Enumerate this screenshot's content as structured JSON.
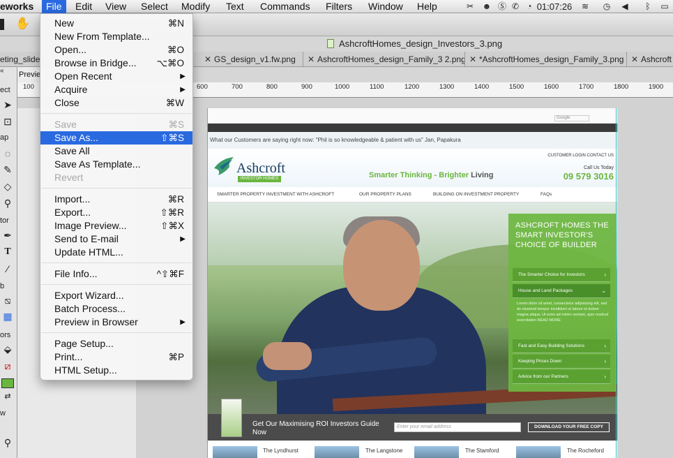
{
  "menubar": {
    "app": "eworks",
    "items": [
      "File",
      "Edit",
      "View",
      "Select",
      "Modify",
      "Text",
      "Commands",
      "Filters",
      "Window",
      "Help"
    ],
    "clock": "01:07:26"
  },
  "window": {
    "title": "AshcroftHomes_design_Investors_3.png"
  },
  "tabs": [
    {
      "label": "eting_slide"
    },
    {
      "label": "GS_design_v1.fw.png"
    },
    {
      "label": "AshcroftHomes_design_Family_3 2.png"
    },
    {
      "label": "*AshcroftHomes_design_Family_3.png"
    },
    {
      "label": "Ashcroft"
    }
  ],
  "preview_tab": "Previe",
  "tool_panel": {
    "labels": [
      "ect",
      "ap",
      "tor",
      "b",
      "ors",
      "w"
    ]
  },
  "ruler": {
    "ticks": [
      "100",
      "600",
      "700",
      "800",
      "900",
      "1000",
      "1100",
      "1200",
      "1300",
      "1400",
      "1500",
      "1600",
      "1700",
      "1800",
      "1900"
    ]
  },
  "file_menu": {
    "groups": [
      [
        {
          "label": "New",
          "shortcut": "⌘N"
        },
        {
          "label": "New From Template...",
          "shortcut": ""
        },
        {
          "label": "Open...",
          "shortcut": "⌘O"
        },
        {
          "label": "Browse in Bridge...",
          "shortcut": "⌥⌘O"
        },
        {
          "label": "Open Recent",
          "submenu": true
        },
        {
          "label": "Acquire",
          "submenu": true
        },
        {
          "label": "Close",
          "shortcut": "⌘W"
        }
      ],
      [
        {
          "label": "Save",
          "shortcut": "⌘S",
          "disabled": true
        },
        {
          "label": "Save As...",
          "shortcut": "⇧⌘S",
          "highlight": true
        },
        {
          "label": "Save All",
          "shortcut": ""
        },
        {
          "label": "Save As Template...",
          "shortcut": ""
        },
        {
          "label": "Revert",
          "shortcut": "",
          "disabled": true
        }
      ],
      [
        {
          "label": "Import...",
          "shortcut": "⌘R"
        },
        {
          "label": "Export...",
          "shortcut": "⇧⌘R"
        },
        {
          "label": "Image Preview...",
          "shortcut": "⇧⌘X"
        },
        {
          "label": "Send to E-mail",
          "submenu": true
        },
        {
          "label": "Update HTML...",
          "shortcut": ""
        }
      ],
      [
        {
          "label": "File Info...",
          "shortcut": "^⇧⌘F"
        }
      ],
      [
        {
          "label": "Export Wizard...",
          "shortcut": ""
        },
        {
          "label": "Batch Process...",
          "shortcut": ""
        },
        {
          "label": "Preview in Browser",
          "submenu": true
        }
      ],
      [
        {
          "label": "Page Setup...",
          "shortcut": ""
        },
        {
          "label": "Print...",
          "shortcut": "⌘P"
        },
        {
          "label": "HTML Setup...",
          "shortcut": ""
        }
      ]
    ]
  },
  "site": {
    "google_box": "Google",
    "testimonial": "What our Customers are saying right now: \"Phil is so knowledgeable & patient with us\" Jan, Papakura",
    "logo": {
      "name": "Ashcroft",
      "sub": "INVESTOR HOMES"
    },
    "tagline": {
      "green": "Smarter Thinking - ",
      "dark_1": "Brighter",
      "dark_2": " Living"
    },
    "top_links": "CUSTOMER LOGIN    CONTACT US",
    "call_label": "Call Us Today",
    "phone": "09 579 3016",
    "nav": [
      "SMARTER PROPERTY INVESTMENT WITH ASHCROFT",
      "OUR PROPERTY PLANS",
      "BUILDING ON INVESTMENT PROPERTY",
      "FAQs"
    ],
    "panel": {
      "heading": "ASHCROFT HOMES THE SMART INVESTOR'S CHOICE OF BUILDER",
      "rows": [
        "The Smarter Choice for Investors",
        "House and Land Packages",
        "Fast and Easy Building Solutions",
        "Keeping Prices Down",
        "Advice from our Partners"
      ],
      "paragraph": "Lorem dolor sit amet, consectetur adipisicing elit, sed do eiusmod tempor incididunt ut labore et dolore magna aliqua. Ut enim ad minim veniam, quis nostrud exercitation READ MORE"
    },
    "cta": {
      "text": "Get Our Maximising ROI Investors Guide Now",
      "input_placeholder": "Enter your email address",
      "button": "DOWNLOAD YOUR FREE COPY"
    },
    "houses": [
      "The Lyndhurst",
      "The Langstone",
      "The Stamford",
      "The Rocheford"
    ]
  },
  "colors": {
    "menu_highlight": "#2a6ae0",
    "brand_green": "#6ab63f",
    "guide": "#35c7c7"
  }
}
